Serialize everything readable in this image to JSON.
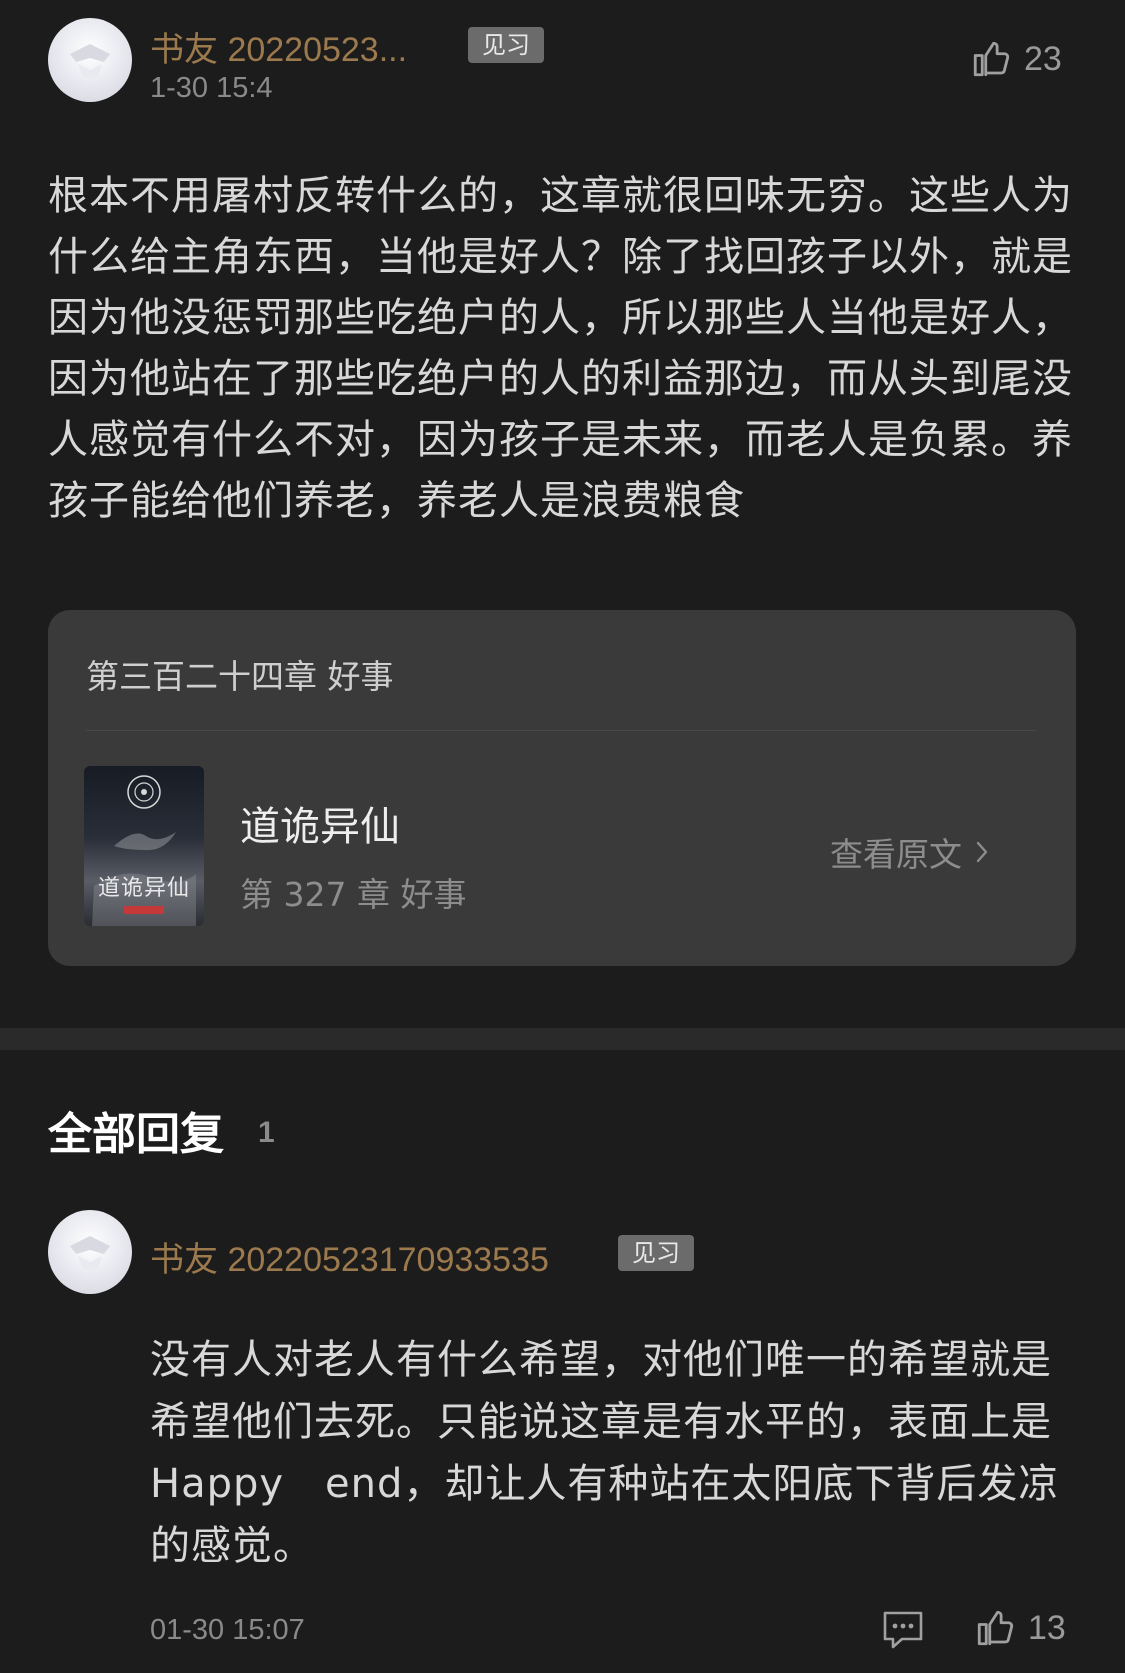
{
  "post": {
    "username": "书友 20220523...",
    "badge": "见习",
    "date": "1-30 15:4",
    "like_count": "23",
    "content": "根本不用屠村反转什么的，这章就很回味无穷。这些人为什么给主角东西，当他是好人？除了找回孩子以外，就是因为他没惩罚那些吃绝户的人，所以那些人当他是好人，因为他站在了那些吃绝户的人的利益那边，而从头到尾没人感觉有什么不对，因为孩子是未来，而老人是负累。养孩子能给他们养老，养老人是浪费粮食"
  },
  "chapter_card": {
    "chapter_title": "第三百二十四章 好事",
    "cover_title": "道诡异仙",
    "book_name": "道诡异仙",
    "book_chapter": "第 327 章 好事",
    "view_original": "查看原文"
  },
  "replies": {
    "title": "全部回复",
    "count": "1",
    "items": [
      {
        "username": "书友 20220523170933535",
        "badge": "见习",
        "content": "没有人对老人有什么希望，对他们唯一的希望就是希望他们去死。只能说这章是有水平的，表面上是Happy　end，却让人有种站在太阳底下背后发凉的感觉。",
        "date": "01-30 15:07",
        "like_count": "13"
      }
    ]
  },
  "colors": {
    "background": "#1c1c1c",
    "username": "#9c7a4e",
    "card": "#3b3a3b",
    "badge": "#6b6b6b"
  },
  "icons": [
    "avatar-placeholder",
    "thumbs-up-icon",
    "chevron-right-icon",
    "comment-icon"
  ]
}
